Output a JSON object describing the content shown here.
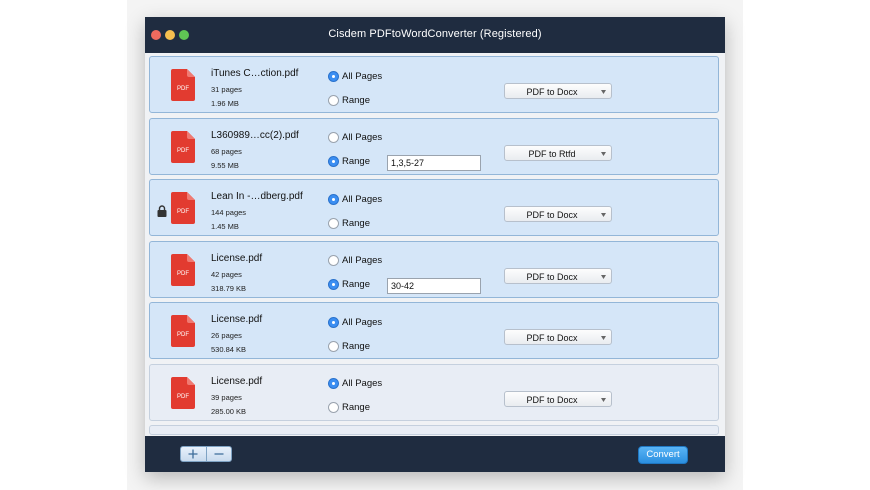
{
  "window": {
    "title": "Cisdem PDFtoWordConverter (Registered)"
  },
  "labels": {
    "all_pages": "All Pages",
    "range": "Range",
    "pdf_icon_text": "PDF"
  },
  "files": [
    {
      "name": "iTunes C…ction.pdf",
      "pages": "31 pages",
      "size": "1.96 MB",
      "mode": "all",
      "range": "",
      "format": "PDF to Docx",
      "locked": false,
      "selected": true
    },
    {
      "name": "L360989…cc(2).pdf",
      "pages": "68 pages",
      "size": "9.55 MB",
      "mode": "range",
      "range": "1,3,5-27",
      "format": "PDF to Rtfd",
      "locked": false,
      "selected": true
    },
    {
      "name": "Lean In -…dberg.pdf",
      "pages": "144 pages",
      "size": "1.45 MB",
      "mode": "all",
      "range": "",
      "format": "PDF to Docx",
      "locked": true,
      "selected": true
    },
    {
      "name": "License.pdf",
      "pages": "42 pages",
      "size": "318.79 KB",
      "mode": "range",
      "range": "30-42",
      "format": "PDF to Docx",
      "locked": false,
      "selected": true
    },
    {
      "name": "License.pdf",
      "pages": "26 pages",
      "size": "530.84 KB",
      "mode": "all",
      "range": "",
      "format": "PDF to Docx",
      "locked": false,
      "selected": true
    },
    {
      "name": "License.pdf",
      "pages": "39 pages",
      "size": "285.00 KB",
      "mode": "all",
      "range": "",
      "format": "PDF to Docx",
      "locked": false,
      "selected": false
    }
  ],
  "toolbar": {
    "convert_label": "Convert"
  },
  "colors": {
    "titlebar": "#1f2c40",
    "row_selected": "#d5e6f8",
    "row_unselected": "#e8edf5",
    "pdf_red": "#e23b30",
    "accent": "#3b8ef2"
  }
}
